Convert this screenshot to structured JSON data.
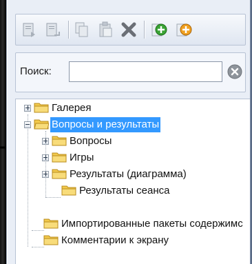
{
  "toolbar": {
    "buttons": [
      {
        "icon": "import-content-icon"
      },
      {
        "icon": "export-content-icon"
      },
      {
        "icon": "copy-icon"
      },
      {
        "icon": "paste-icon"
      },
      {
        "icon": "delete-icon"
      },
      {
        "icon": "add-green-icon"
      },
      {
        "icon": "add-orange-icon"
      }
    ]
  },
  "search": {
    "label": "Поиск:",
    "value": ""
  },
  "tree": {
    "items": [
      {
        "label": "Галерея",
        "expander": "plus"
      },
      {
        "label": "Вопросы и результаты",
        "expander": "minus",
        "selected": true
      },
      {
        "label": "Вопросы",
        "expander": "plus"
      },
      {
        "label": "Игры",
        "expander": "plus"
      },
      {
        "label": "Результаты (диаграмма)",
        "expander": "plus"
      },
      {
        "label": "Результаты сеанса",
        "expander": "none"
      },
      {
        "label": "Импортированные пакеты содержимс",
        "expander": "none"
      },
      {
        "label": "Комментарии к экрану",
        "expander": "none"
      }
    ]
  },
  "colors": {
    "selection": "#3399ff",
    "folder": "#f2c94c",
    "add_green": "#3aa335",
    "add_orange": "#f0a020",
    "delete": "#6b6f76"
  }
}
